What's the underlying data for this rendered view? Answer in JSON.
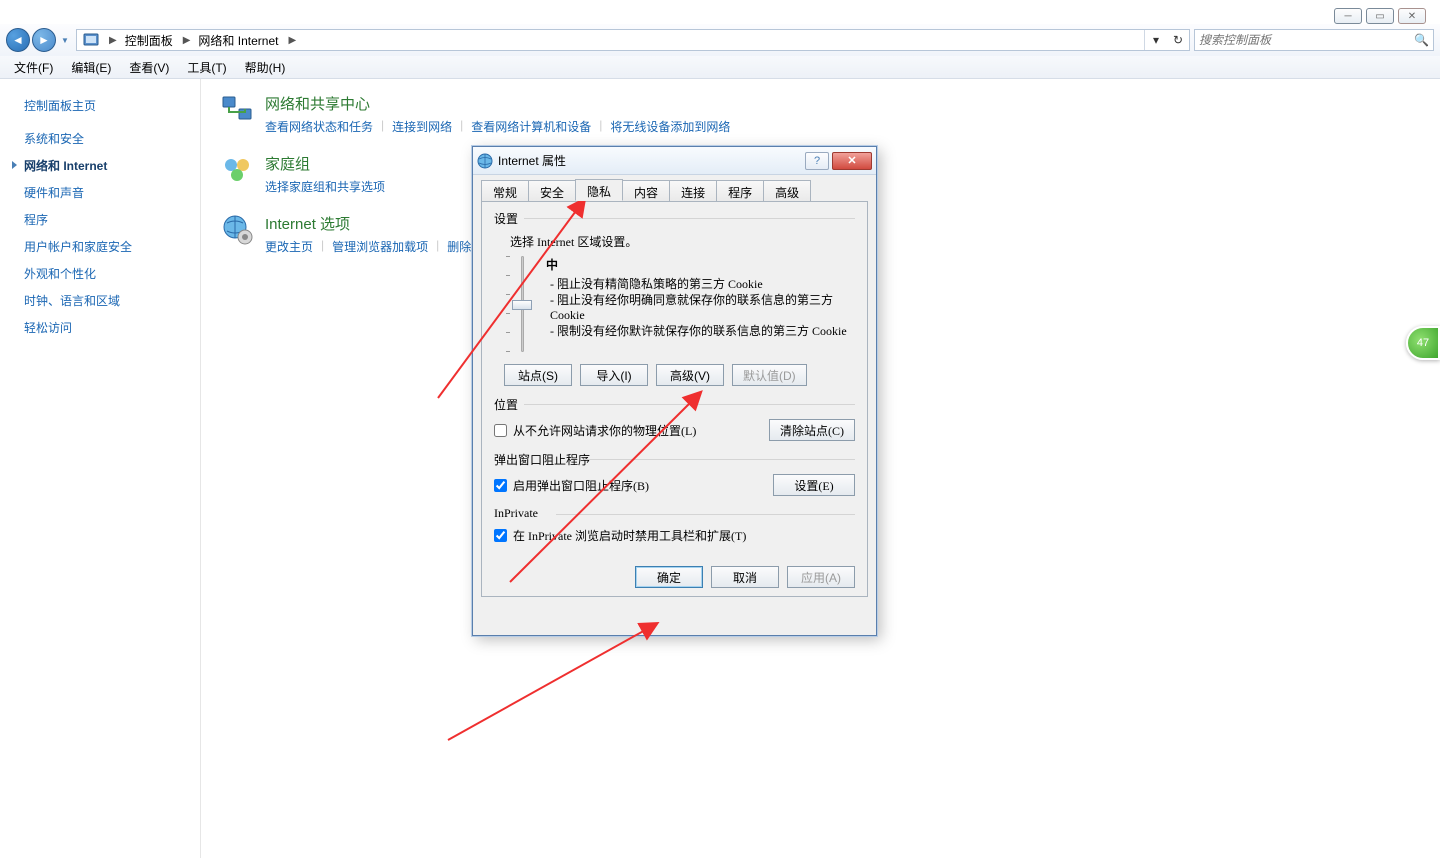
{
  "breadcrumb": {
    "item1": "控制面板",
    "item2": "网络和 Internet"
  },
  "search": {
    "placeholder": "搜索控制面板"
  },
  "menus": {
    "file": "文件(F)",
    "edit": "编辑(E)",
    "view": "查看(V)",
    "tools": "工具(T)",
    "help": "帮助(H)"
  },
  "sidebar": {
    "items": [
      {
        "label": "控制面板主页"
      },
      {
        "label": "系统和安全"
      },
      {
        "label": "网络和 Internet"
      },
      {
        "label": "硬件和声音"
      },
      {
        "label": "程序"
      },
      {
        "label": "用户帐户和家庭安全"
      },
      {
        "label": "外观和个性化"
      },
      {
        "label": "时钟、语言和区域"
      },
      {
        "label": "轻松访问"
      }
    ]
  },
  "categories": {
    "net": {
      "title": "网络和共享中心",
      "l1": "查看网络状态和任务",
      "l2": "连接到网络",
      "l3": "查看网络计算机和设备",
      "l4": "将无线设备添加到网络"
    },
    "home": {
      "title": "家庭组",
      "l1": "选择家庭组和共享选项"
    },
    "ie": {
      "title": "Internet 选项",
      "l1": "更改主页",
      "l2": "管理浏览器加载项",
      "l3": "删除浏览的历史记录和 cookie"
    }
  },
  "dialog": {
    "title": "Internet 属性",
    "tabs": {
      "general": "常规",
      "security": "安全",
      "privacy": "隐私",
      "content": "内容",
      "conn": "连接",
      "prog": "程序",
      "adv": "高级"
    },
    "group_settings": "设置",
    "settings_desc": "选择 Internet 区域设置。",
    "slider_level": "中",
    "bullet1": "- 阻止没有精简隐私策略的第三方 Cookie",
    "bullet2": "- 阻止没有经你明确同意就保存你的联系信息的第三方 Cookie",
    "bullet3": "- 限制没有经你默许就保存你的联系信息的第三方 Cookie",
    "btn_sites": "站点(S)",
    "btn_import": "导入(I)",
    "btn_adv": "高级(V)",
    "btn_default": "默认值(D)",
    "group_loc": "位置",
    "loc_check": "从不允许网站请求你的物理位置(L)",
    "btn_clear_sites": "清除站点(C)",
    "group_popup": "弹出窗口阻止程序",
    "popup_check": "启用弹出窗口阻止程序(B)",
    "btn_settings": "设置(E)",
    "group_inprivate": "InPrivate",
    "inprivate_check": "在 InPrivate 浏览启动时禁用工具栏和扩展(T)",
    "btn_ok": "确定",
    "btn_cancel": "取消",
    "btn_apply": "应用(A)"
  },
  "badge": "47"
}
